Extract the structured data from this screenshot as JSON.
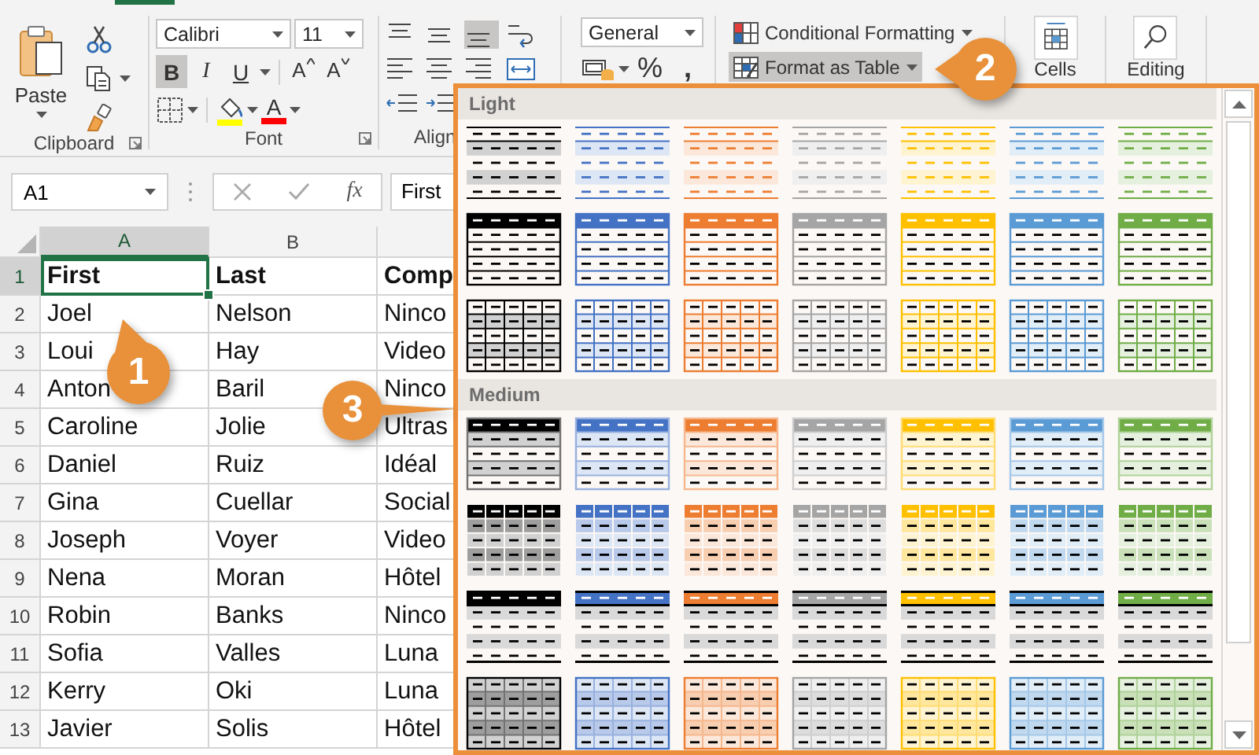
{
  "ribbon": {
    "clipboard": {
      "paste": "Paste",
      "label": "Clipboard"
    },
    "font": {
      "name": "Calibri",
      "size": "11",
      "label": "Font",
      "styles": [
        {
          "label": "B",
          "kind": "bold",
          "on": true
        },
        {
          "label": "I",
          "kind": "italic",
          "on": false
        },
        {
          "label": "U",
          "kind": "underline",
          "on": false
        }
      ],
      "resize": [
        {
          "label": "A",
          "kind": "grow"
        },
        {
          "label": "A",
          "kind": "shrink"
        }
      ],
      "font_color": {
        "label": "A"
      }
    },
    "alignment": {
      "label": "Align",
      "buttons": [
        {
          "kind": "top",
          "on": false
        },
        {
          "kind": "middle",
          "on": false
        },
        {
          "kind": "bottom",
          "on": true
        },
        {
          "kind": "left",
          "on": false
        },
        {
          "kind": "center",
          "on": false
        },
        {
          "kind": "right",
          "on": false
        }
      ]
    },
    "number": {
      "format": "General",
      "percent": "%",
      "comma": ","
    },
    "styles": {
      "buttons": [
        {
          "label": "Conditional Formatting",
          "selected": false
        },
        {
          "label": "Format as Table",
          "selected": true
        }
      ]
    },
    "cells": {
      "label": "Cells"
    },
    "editing": {
      "label": "Editing"
    }
  },
  "formula_bar": {
    "name_box": "A1",
    "insert_function": "fx",
    "value": "First"
  },
  "sheet": {
    "columns": [
      {
        "label": "A",
        "selected": true
      },
      {
        "label": "B",
        "selected": false
      }
    ],
    "rows": [
      {
        "number": "1",
        "selected": true,
        "bold": true,
        "cells": [
          {
            "text": "First",
            "selected": true
          },
          {
            "text": "Last",
            "selected": false
          },
          {
            "text": "Comp",
            "selected": false
          }
        ]
      },
      {
        "number": "2",
        "selected": false,
        "bold": false,
        "cells": [
          {
            "text": "Joel",
            "selected": false
          },
          {
            "text": "Nelson",
            "selected": false
          },
          {
            "text": "Ninco",
            "selected": false
          }
        ]
      },
      {
        "number": "3",
        "selected": false,
        "bold": false,
        "cells": [
          {
            "text": "Loui",
            "selected": false
          },
          {
            "text": "Hay",
            "selected": false
          },
          {
            "text": "Video",
            "selected": false
          }
        ]
      },
      {
        "number": "4",
        "selected": false,
        "bold": false,
        "cells": [
          {
            "text": "Anton",
            "selected": false
          },
          {
            "text": "Baril",
            "selected": false
          },
          {
            "text": "Ninco",
            "selected": false
          }
        ]
      },
      {
        "number": "5",
        "selected": false,
        "bold": false,
        "cells": [
          {
            "text": "Caroline",
            "selected": false
          },
          {
            "text": "Jolie",
            "selected": false
          },
          {
            "text": "Ultras",
            "selected": false
          }
        ]
      },
      {
        "number": "6",
        "selected": false,
        "bold": false,
        "cells": [
          {
            "text": "Daniel",
            "selected": false
          },
          {
            "text": "Ruiz",
            "selected": false
          },
          {
            "text": "Idéal",
            "selected": false
          }
        ]
      },
      {
        "number": "7",
        "selected": false,
        "bold": false,
        "cells": [
          {
            "text": "Gina",
            "selected": false
          },
          {
            "text": "Cuellar",
            "selected": false
          },
          {
            "text": "Social",
            "selected": false
          }
        ]
      },
      {
        "number": "8",
        "selected": false,
        "bold": false,
        "cells": [
          {
            "text": "Joseph",
            "selected": false
          },
          {
            "text": "Voyer",
            "selected": false
          },
          {
            "text": "Video",
            "selected": false
          }
        ]
      },
      {
        "number": "9",
        "selected": false,
        "bold": false,
        "cells": [
          {
            "text": "Nena",
            "selected": false
          },
          {
            "text": "Moran",
            "selected": false
          },
          {
            "text": "Hôtel",
            "selected": false
          }
        ]
      },
      {
        "number": "10",
        "selected": false,
        "bold": false,
        "cells": [
          {
            "text": "Robin",
            "selected": false
          },
          {
            "text": "Banks",
            "selected": false
          },
          {
            "text": "Ninco",
            "selected": false
          }
        ]
      },
      {
        "number": "11",
        "selected": false,
        "bold": false,
        "cells": [
          {
            "text": "Sofia",
            "selected": false
          },
          {
            "text": "Valles",
            "selected": false
          },
          {
            "text": "Luna",
            "selected": false
          }
        ]
      },
      {
        "number": "12",
        "selected": false,
        "bold": false,
        "cells": [
          {
            "text": "Kerry",
            "selected": false
          },
          {
            "text": "Oki",
            "selected": false
          },
          {
            "text": "Luna",
            "selected": false
          }
        ]
      },
      {
        "number": "13",
        "selected": false,
        "bold": false,
        "cells": [
          {
            "text": "Javier",
            "selected": false
          },
          {
            "text": "Solis",
            "selected": false
          },
          {
            "text": "Hôtel",
            "selected": false
          }
        ]
      }
    ]
  },
  "gallery": {
    "sections": [
      {
        "label": "Light",
        "rows": [
          {
            "kind": "lines",
            "styles": [
              {
                "color": "#000000"
              },
              {
                "color": "#4472c4"
              },
              {
                "color": "#ed7d31"
              },
              {
                "color": "#a5a5a5"
              },
              {
                "color": "#ffc000"
              },
              {
                "color": "#5b9bd5"
              },
              {
                "color": "#70ad47"
              }
            ]
          },
          {
            "kind": "header",
            "styles": [
              {
                "color": "#000000"
              },
              {
                "color": "#4472c4"
              },
              {
                "color": "#ed7d31"
              },
              {
                "color": "#a5a5a5"
              },
              {
                "color": "#ffc000"
              },
              {
                "color": "#5b9bd5"
              },
              {
                "color": "#70ad47"
              }
            ]
          },
          {
            "kind": "grid",
            "styles": [
              {
                "color": "#000000"
              },
              {
                "color": "#4472c4"
              },
              {
                "color": "#ed7d31"
              },
              {
                "color": "#a5a5a5"
              },
              {
                "color": "#ffc000"
              },
              {
                "color": "#5b9bd5"
              },
              {
                "color": "#70ad47"
              }
            ]
          }
        ]
      },
      {
        "label": "Medium",
        "rows": [
          {
            "kind": "header-banded",
            "styles": [
              {
                "color": "#000000"
              },
              {
                "color": "#4472c4"
              },
              {
                "color": "#ed7d31"
              },
              {
                "color": "#a5a5a5"
              },
              {
                "color": "#ffc000"
              },
              {
                "color": "#5b9bd5"
              },
              {
                "color": "#70ad47"
              }
            ]
          },
          {
            "kind": "header-grid",
            "styles": [
              {
                "color": "#000000"
              },
              {
                "color": "#4472c4"
              },
              {
                "color": "#ed7d31"
              },
              {
                "color": "#a5a5a5"
              },
              {
                "color": "#ffc000"
              },
              {
                "color": "#5b9bd5"
              },
              {
                "color": "#70ad47"
              }
            ]
          },
          {
            "kind": "header-lines",
            "styles": [
              {
                "color": "#000000"
              },
              {
                "color": "#4472c4"
              },
              {
                "color": "#ed7d31"
              },
              {
                "color": "#a5a5a5"
              },
              {
                "color": "#ffc000"
              },
              {
                "color": "#5b9bd5"
              },
              {
                "color": "#70ad47"
              }
            ]
          },
          {
            "kind": "tinted-grid",
            "styles": [
              {
                "color": "#000000"
              },
              {
                "color": "#4472c4"
              },
              {
                "color": "#ed7d31"
              },
              {
                "color": "#a5a5a5"
              },
              {
                "color": "#ffc000"
              },
              {
                "color": "#5b9bd5"
              },
              {
                "color": "#70ad47"
              }
            ]
          }
        ]
      }
    ]
  },
  "callouts": [
    {
      "number": "1"
    },
    {
      "number": "2"
    },
    {
      "number": "3"
    }
  ]
}
